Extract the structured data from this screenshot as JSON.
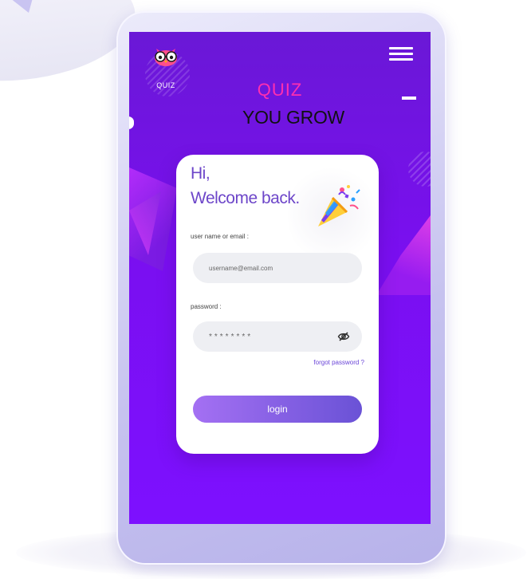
{
  "app": {
    "logo_text": "QUIZ",
    "title_line1": "QUIZ",
    "title_line2": "YOU GROW"
  },
  "card": {
    "greeting_line1": "Hi,",
    "greeting_line2": "Welcome back.",
    "username_label": "user name or email :",
    "username_placeholder": "username@email.com",
    "password_label": "password :",
    "password_value": "********",
    "forgot_label": "forgot password ?",
    "login_label": "login"
  },
  "icons": {
    "menu": "hamburger-menu-icon",
    "eye": "eye-slash-icon",
    "logo": "owl-logo-icon",
    "party": "party-popper-icon"
  },
  "colors": {
    "screen_top": "#6a18d6",
    "screen_bottom": "#7d10ff",
    "title_accent": "#ff2fb0",
    "greeting": "#6d46c9",
    "button_start": "#a470f3",
    "button_end": "#6a52d6"
  }
}
